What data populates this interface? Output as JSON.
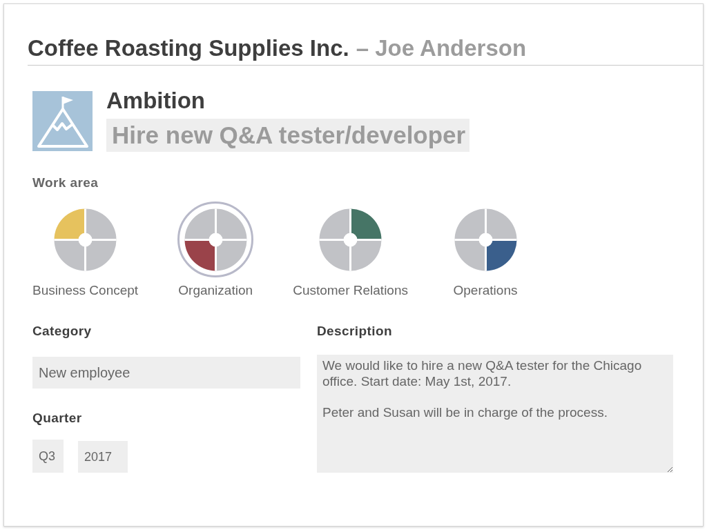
{
  "header": {
    "company": "Coffee Roasting Supplies Inc.",
    "person": "– Joe Anderson"
  },
  "goal": {
    "type": "Ambition",
    "title": "Hire new Q&A tester/developer"
  },
  "work_area": {
    "label": "Work area",
    "items": [
      {
        "label": "Business Concept",
        "kind": "topleft",
        "color": "#e6c25e",
        "selected": false
      },
      {
        "label": "Organization",
        "kind": "bottomleft",
        "color": "#9a434a",
        "selected": true
      },
      {
        "label": "Customer Relations",
        "kind": "topright",
        "color": "#467566",
        "selected": false
      },
      {
        "label": "Operations",
        "kind": "bottomright",
        "color": "#3a5f8c",
        "selected": false
      }
    ]
  },
  "category": {
    "label": "Category",
    "value": "New employee"
  },
  "quarter": {
    "label": "Quarter",
    "quarter": "Q3",
    "year": "2017"
  },
  "description": {
    "label": "Description",
    "value": "We would like to hire a new Q&A tester for the Chicago office. Start date: May 1st, 2017.\n\nPeter and Susan will be in charge of the process."
  }
}
